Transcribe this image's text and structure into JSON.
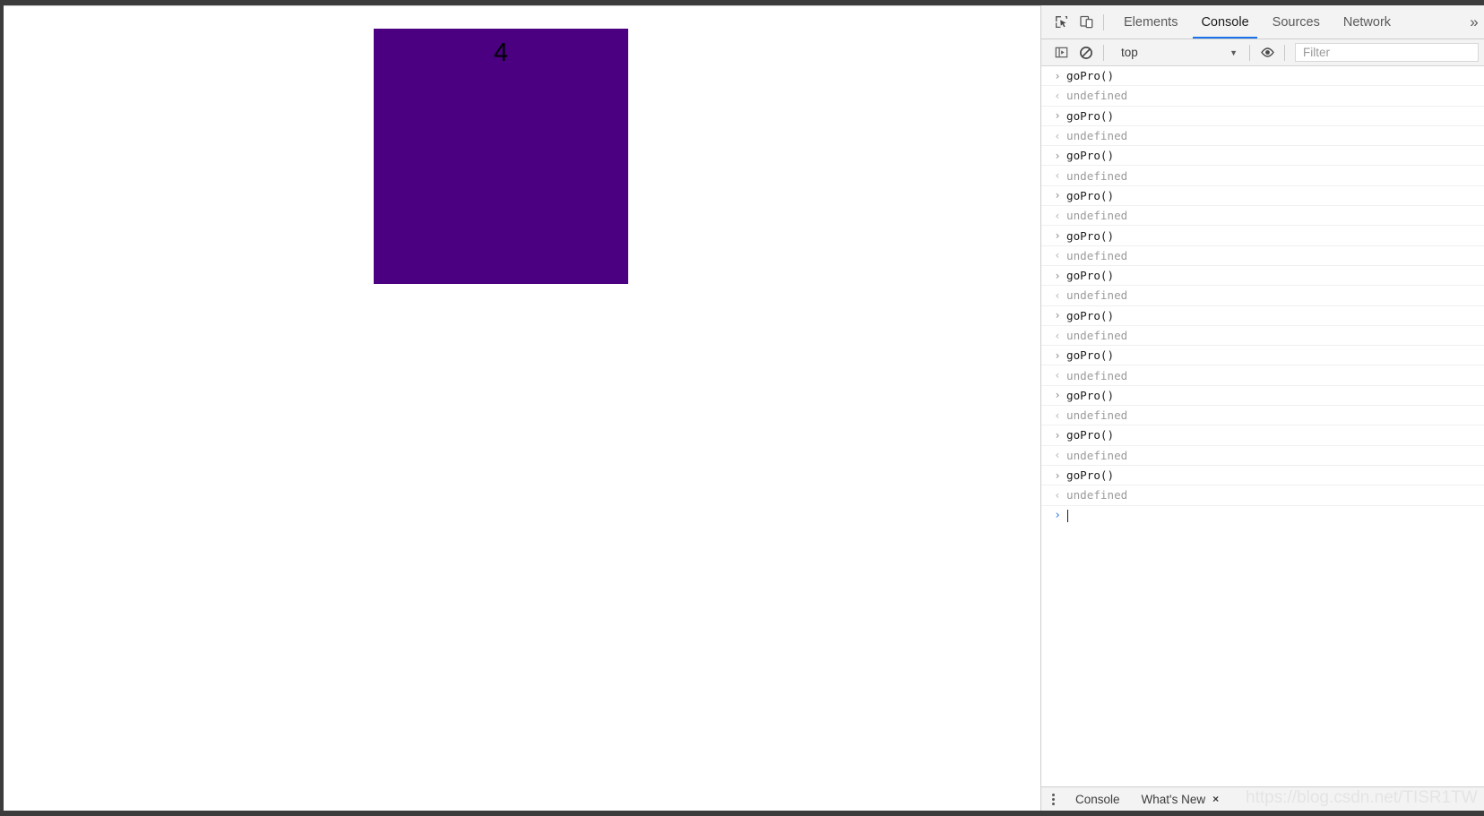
{
  "page": {
    "box_label": "4",
    "box_color": "#4b0082"
  },
  "devtools": {
    "toolbar_icons": [
      {
        "name": "inspect-element-icon",
        "title": "Inspect element"
      },
      {
        "name": "device-toolbar-icon",
        "title": "Toggle device toolbar"
      }
    ],
    "tabs": [
      {
        "label": "Elements",
        "active": false
      },
      {
        "label": "Console",
        "active": true
      },
      {
        "label": "Sources",
        "active": false
      },
      {
        "label": "Network",
        "active": false
      }
    ],
    "more_tabs_label": "»",
    "console_toolbar": {
      "sidebar_toggle_icon": "console-sidebar-icon",
      "clear_icon": "clear-console-icon",
      "context_value": "top",
      "caret": "▼",
      "eye_icon": "live-expression-icon",
      "filter_placeholder": "Filter",
      "filter_value": ""
    },
    "messages": [
      {
        "kind": "input",
        "marker": "›",
        "text": "goPro()"
      },
      {
        "kind": "output",
        "marker": "‹",
        "text": "undefined"
      },
      {
        "kind": "input",
        "marker": "›",
        "text": "goPro()"
      },
      {
        "kind": "output",
        "marker": "‹",
        "text": "undefined"
      },
      {
        "kind": "input",
        "marker": "›",
        "text": "goPro()"
      },
      {
        "kind": "output",
        "marker": "‹",
        "text": "undefined"
      },
      {
        "kind": "input",
        "marker": "›",
        "text": "goPro()"
      },
      {
        "kind": "output",
        "marker": "‹",
        "text": "undefined"
      },
      {
        "kind": "input",
        "marker": "›",
        "text": "goPro()"
      },
      {
        "kind": "output",
        "marker": "‹",
        "text": "undefined"
      },
      {
        "kind": "input",
        "marker": "›",
        "text": "goPro()"
      },
      {
        "kind": "output",
        "marker": "‹",
        "text": "undefined"
      },
      {
        "kind": "input",
        "marker": "›",
        "text": "goPro()"
      },
      {
        "kind": "output",
        "marker": "‹",
        "text": "undefined"
      },
      {
        "kind": "input",
        "marker": "›",
        "text": "goPro()"
      },
      {
        "kind": "output",
        "marker": "‹",
        "text": "undefined"
      },
      {
        "kind": "input",
        "marker": "›",
        "text": "goPro()"
      },
      {
        "kind": "output",
        "marker": "‹",
        "text": "undefined"
      },
      {
        "kind": "input",
        "marker": "›",
        "text": "goPro()"
      },
      {
        "kind": "output",
        "marker": "‹",
        "text": "undefined"
      },
      {
        "kind": "input",
        "marker": "›",
        "text": "goPro()"
      },
      {
        "kind": "output",
        "marker": "‹",
        "text": "undefined"
      },
      {
        "kind": "prompt",
        "marker": "›",
        "text": ""
      }
    ],
    "drawer": {
      "tabs": [
        {
          "label": "Console",
          "closable": false
        },
        {
          "label": "What's New",
          "closable": true,
          "close_label": "×"
        }
      ],
      "watermark": "https://blog.csdn.net/TISR1TW"
    }
  }
}
